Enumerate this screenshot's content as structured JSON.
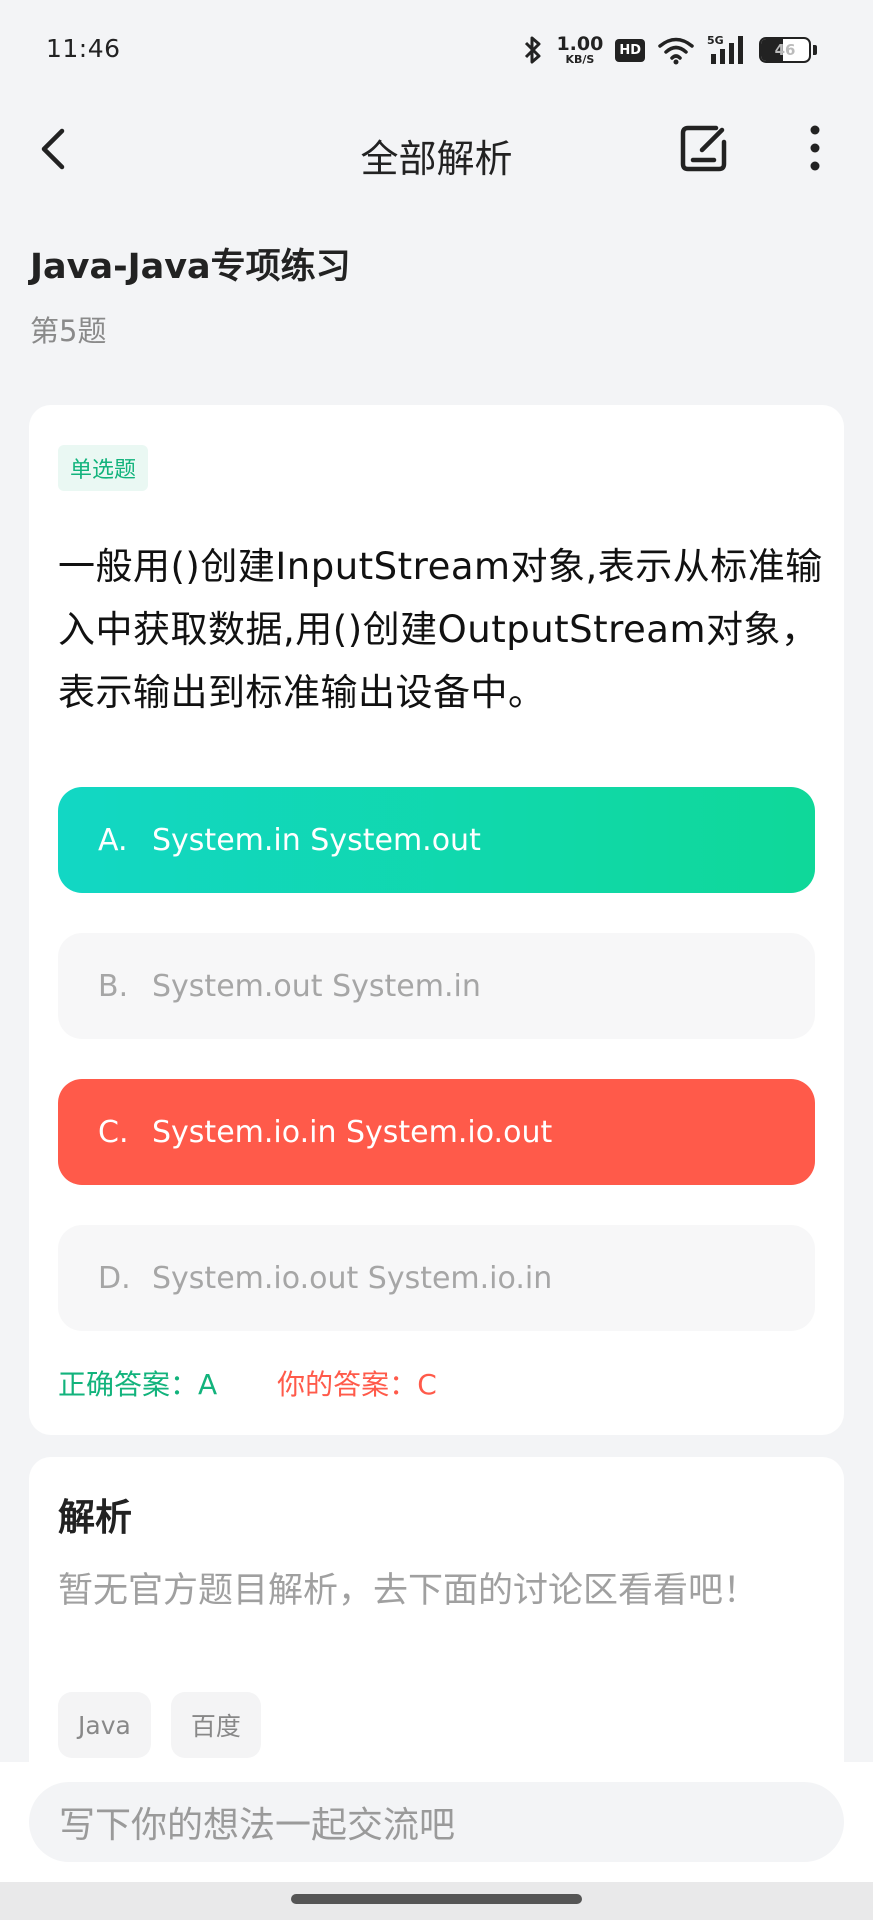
{
  "status_bar": {
    "time": "11:46",
    "net_speed_value": "1.00",
    "net_speed_unit": "KB/S",
    "hd_label": "HD",
    "signal_label": "5G",
    "battery_level": "46",
    "icons": [
      "bluetooth-icon",
      "hd-icon",
      "wifi-icon",
      "signal-icon",
      "battery-icon"
    ]
  },
  "header": {
    "title": "全部解析",
    "icons": [
      "back-arrow-icon",
      "edit-note-icon",
      "more-vertical-icon"
    ]
  },
  "exam": {
    "title": "Java-Java专项练习",
    "question_no": "第5题"
  },
  "question": {
    "type": "单选题",
    "text": "一般用()创建InputStream对象,表示从标准输入中获取数据,用()创建OutputStream对象，表示输出到标准输出设备中。",
    "options": [
      {
        "letter": "A.",
        "text": "System.in System.out",
        "state": "correct"
      },
      {
        "letter": "B.",
        "text": "System.out System.in",
        "state": "neutral"
      },
      {
        "letter": "C.",
        "text": "System.io.in System.io.out",
        "state": "wrong"
      },
      {
        "letter": "D.",
        "text": "System.io.out System.io.in",
        "state": "neutral"
      }
    ],
    "correct_answer_label": "正确答案：",
    "correct_answer": "A",
    "your_answer_label": "你的答案：",
    "your_answer": "C"
  },
  "analysis": {
    "title": "解析",
    "text": "暂无官方题目解析，去下面的讨论区看看吧！",
    "tags": [
      "Java",
      "百度"
    ]
  },
  "comment": {
    "placeholder": "写下你的想法一起交流吧"
  },
  "colors": {
    "correct": "#12b37c",
    "wrong": "#ff5a4a",
    "correct_gradient_start": "#12d7c4",
    "correct_gradient_end": "#0fd899"
  }
}
